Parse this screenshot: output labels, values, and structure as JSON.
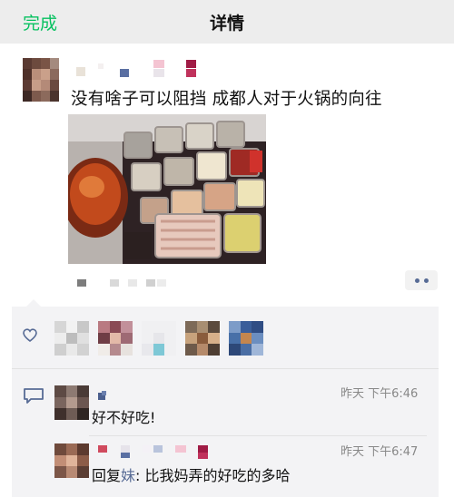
{
  "navbar": {
    "done_label": "完成",
    "title": "详情"
  },
  "post": {
    "text": "没有啥子可以阻挡 成都人对于火锅的向往",
    "image_alt": "hot pot ingredients photo"
  },
  "comments": [
    {
      "time": "昨天 下午6:46",
      "text": "好不好吃!"
    },
    {
      "time": "昨天 下午6:47",
      "reply_word": "回复",
      "reply_target": "妹",
      "text": ": 比我妈弄的好吃的多哈"
    }
  ],
  "colors": {
    "accent_green": "#07c160",
    "link_blue": "#576b95",
    "panel_bg": "#f3f3f5",
    "nav_bg": "#ededed"
  },
  "icons": {
    "heart": "heart-icon",
    "comment": "comment-icon",
    "more": "more-dots-icon"
  }
}
